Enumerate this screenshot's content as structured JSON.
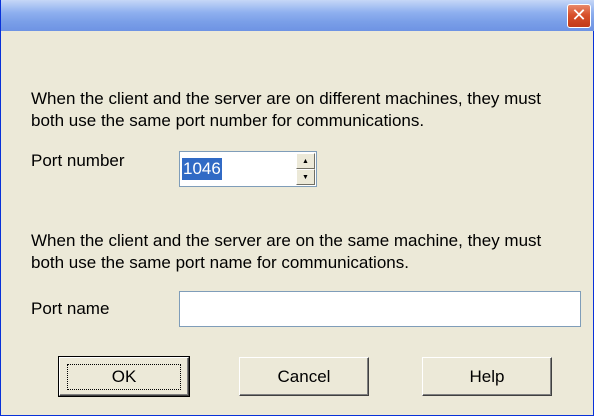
{
  "dialog": {
    "close_glyph": "✕"
  },
  "port_number_section": {
    "message": "When the client and the server are on different machines, they must both use the same port number for communications.",
    "label": "Port number",
    "value": "1046"
  },
  "port_name_section": {
    "message": "When the client and the server are on the same machine, they must both use the same port name for communications.",
    "label": "Port name",
    "value": ""
  },
  "buttons": {
    "ok": "OK",
    "cancel": "Cancel",
    "help": "Help"
  },
  "colors": {
    "selection": "#316ac5",
    "close_button": "#d8502b"
  }
}
